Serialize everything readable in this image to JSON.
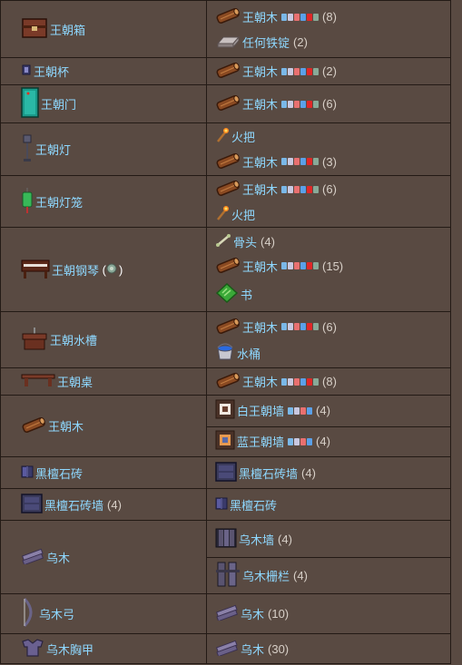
{
  "colors": {
    "link": "#8ed8ff",
    "qty": "#d8d0c8",
    "background": "#594a42",
    "border": "#231a15"
  },
  "rows": [
    {
      "result": {
        "name": "王朝箱",
        "icon": "dynasty-chest-icon"
      },
      "ingredients": [
        {
          "name": "王朝木",
          "icon": "dynasty-wood-icon",
          "qty": "(8)",
          "badges": true
        },
        {
          "name": "任何铁锭",
          "icon": "iron-bar-icon",
          "qty": "(2)"
        }
      ]
    },
    {
      "result": {
        "name": "王朝杯",
        "icon": "dynasty-cup-icon"
      },
      "ingredients": [
        {
          "name": "王朝木",
          "icon": "dynasty-wood-icon",
          "qty": "(2)",
          "badges": true
        }
      ]
    },
    {
      "result": {
        "name": "王朝门",
        "icon": "dynasty-door-icon"
      },
      "ingredients": [
        {
          "name": "王朝木",
          "icon": "dynasty-wood-icon",
          "qty": "(6)",
          "badges": true
        }
      ]
    },
    {
      "result": {
        "name": "王朝灯",
        "icon": "dynasty-lamp-icon"
      },
      "ingredients": [
        {
          "name": "火把",
          "icon": "torch-icon"
        },
        {
          "name": "王朝木",
          "icon": "dynasty-wood-icon",
          "qty": "(3)",
          "badges": true
        }
      ]
    },
    {
      "result": {
        "name": "王朝灯笼",
        "icon": "dynasty-lantern-icon"
      },
      "ingredients": [
        {
          "name": "王朝木",
          "icon": "dynasty-wood-icon",
          "qty": "(6)",
          "badges": true
        },
        {
          "name": "火把",
          "icon": "torch-icon"
        }
      ]
    },
    {
      "result": {
        "name": "王朝钢琴",
        "icon": "dynasty-piano-icon",
        "extra_icon": true
      },
      "ingredients": [
        {
          "name": "骨头",
          "icon": "bone-icon",
          "qty": "(4)"
        },
        {
          "name": "王朝木",
          "icon": "dynasty-wood-icon",
          "qty": "(15)",
          "badges": true
        },
        {
          "name": "书",
          "icon": "book-icon"
        }
      ]
    },
    {
      "result": {
        "name": "王朝水槽",
        "icon": "dynasty-sink-icon"
      },
      "ingredients": [
        {
          "name": "王朝木",
          "icon": "dynasty-wood-icon",
          "qty": "(6)",
          "badges": true
        },
        {
          "name": "水桶",
          "icon": "water-bucket-icon"
        }
      ]
    },
    {
      "result": {
        "name": "王朝桌",
        "icon": "dynasty-table-icon"
      },
      "ingredients": [
        {
          "name": "王朝木",
          "icon": "dynasty-wood-icon",
          "qty": "(8)",
          "badges": true
        }
      ]
    },
    {
      "result": {
        "name": "王朝木",
        "icon": "dynasty-wood-icon"
      },
      "split": true,
      "ingredients": [
        {
          "name": "白王朝墙",
          "icon": "white-dynasty-wall-icon",
          "qty": "(4)",
          "badges_short": true
        },
        {
          "name": "蓝王朝墙",
          "icon": "blue-dynasty-wall-icon",
          "qty": "(4)",
          "badges_short": true
        }
      ]
    },
    {
      "result": {
        "name": "黑檀石砖",
        "icon": "ebonstone-brick-icon"
      },
      "ingredients": [
        {
          "name": "黑檀石砖墙",
          "icon": "ebonstone-brick-wall-icon",
          "qty": "(4)"
        }
      ]
    },
    {
      "result": {
        "name": "黑檀石砖墙",
        "icon": "ebonstone-brick-wall-icon",
        "qty": "(4)"
      },
      "ingredients": [
        {
          "name": "黑檀石砖",
          "icon": "ebonstone-brick-icon"
        }
      ]
    },
    {
      "result": {
        "name": "乌木",
        "icon": "ebonwood-icon"
      },
      "split": true,
      "ingredients": [
        {
          "name": "乌木墙",
          "icon": "ebonwood-wall-icon",
          "qty": "(4)"
        },
        {
          "name": "乌木栅栏",
          "icon": "ebonwood-fence-icon",
          "qty": "(4)"
        }
      ]
    },
    {
      "result": {
        "name": "乌木弓",
        "icon": "ebonwood-bow-icon"
      },
      "ingredients": [
        {
          "name": "乌木",
          "icon": "ebonwood-icon",
          "qty": "(10)"
        }
      ]
    },
    {
      "result": {
        "name": "乌木胸甲",
        "icon": "ebonwood-breastplate-icon"
      },
      "ingredients": [
        {
          "name": "乌木",
          "icon": "ebonwood-icon",
          "qty": "(30)"
        }
      ]
    }
  ]
}
